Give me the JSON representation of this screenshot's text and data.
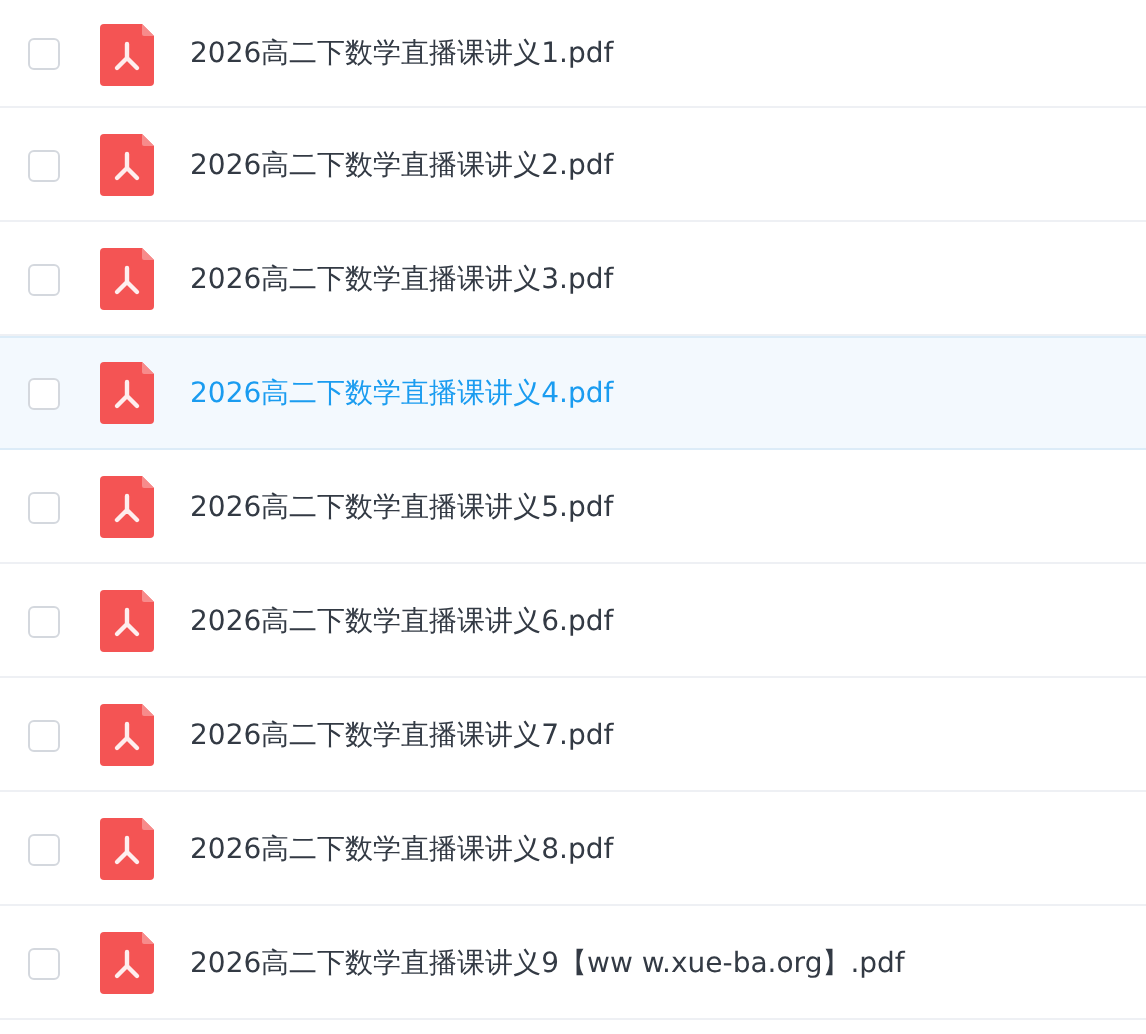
{
  "files": [
    {
      "name": "2026高二下数学直播课讲义1.pdf",
      "checked": false,
      "highlighted": false
    },
    {
      "name": "2026高二下数学直播课讲义2.pdf",
      "checked": false,
      "highlighted": false
    },
    {
      "name": "2026高二下数学直播课讲义3.pdf",
      "checked": false,
      "highlighted": false
    },
    {
      "name": "2026高二下数学直播课讲义4.pdf",
      "checked": false,
      "highlighted": true
    },
    {
      "name": "2026高二下数学直播课讲义5.pdf",
      "checked": false,
      "highlighted": false
    },
    {
      "name": "2026高二下数学直播课讲义6.pdf",
      "checked": false,
      "highlighted": false
    },
    {
      "name": "2026高二下数学直播课讲义7.pdf",
      "checked": false,
      "highlighted": false
    },
    {
      "name": "2026高二下数学直播课讲义8.pdf",
      "checked": false,
      "highlighted": false
    },
    {
      "name": "2026高二下数学直播课讲义9【ww w.xue-ba.org】.pdf",
      "checked": false,
      "highlighted": false
    }
  ]
}
